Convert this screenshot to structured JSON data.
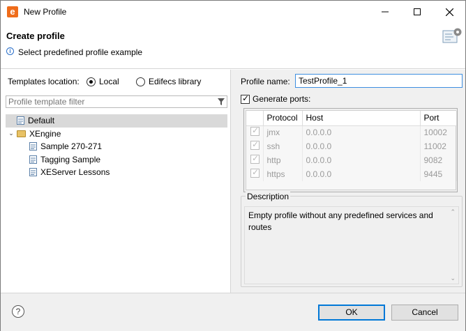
{
  "window": {
    "title": "New Profile",
    "app_icon_letter": "e",
    "minimize_icon": "minimize-icon",
    "maximize_icon": "maximize-icon",
    "close_icon": "close-icon"
  },
  "header": {
    "title": "Create profile",
    "message": "Select predefined profile example",
    "info_icon": "info-icon",
    "wizard_icon": "wizard-settings-icon"
  },
  "left": {
    "templates_location_label": "Templates location:",
    "radio_local": "Local",
    "radio_edifecs": "Edifecs library",
    "selected_location": "Local",
    "filter_placeholder": "Profile template filter",
    "tree": [
      {
        "label": "Default",
        "selected": true
      },
      {
        "label": "XEngine",
        "expanded": true
      },
      {
        "label": "Sample 270-271"
      },
      {
        "label": "Tagging Sample"
      },
      {
        "label": "XEServer Lessons"
      }
    ]
  },
  "right": {
    "profile_name_label": "Profile name:",
    "profile_name_value": "TestProfile_1",
    "generate_ports_label": "Generate ports:",
    "generate_ports_checked": true,
    "ports_columns": [
      "Protocol",
      "Host",
      "Port"
    ],
    "ports_rows": [
      {
        "protocol": "jmx",
        "host": "0.0.0.0",
        "port": "10002"
      },
      {
        "protocol": "ssh",
        "host": "0.0.0.0",
        "port": "11002"
      },
      {
        "protocol": "http",
        "host": "0.0.0.0",
        "port": "9082"
      },
      {
        "protocol": "https",
        "host": "0.0.0.0",
        "port": "9445"
      }
    ],
    "description_label": "Description",
    "description_text": "Empty profile without any predefined services and routes"
  },
  "footer": {
    "help_label": "?",
    "ok_label": "OK",
    "cancel_label": "Cancel"
  },
  "colors": {
    "accent": "#0078d7",
    "app_icon": "#ef6c1a",
    "selection": "#d9d9d9"
  }
}
